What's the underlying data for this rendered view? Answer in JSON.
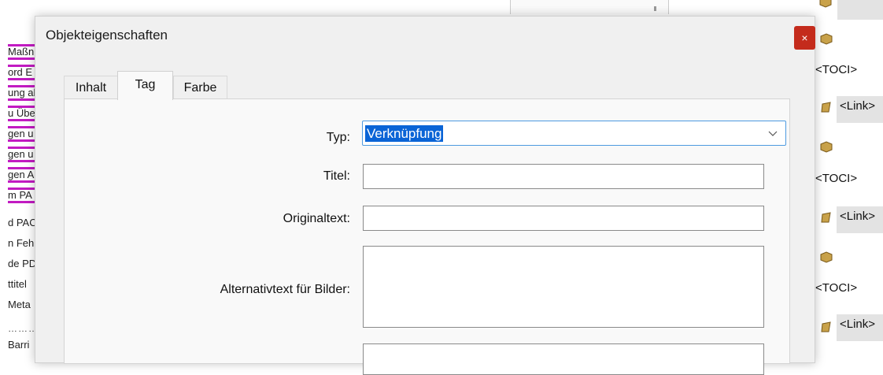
{
  "dialog": {
    "title": "Objekteigenschaften",
    "close_glyph": "×",
    "tabs": [
      {
        "label": "Inhalt",
        "active": false
      },
      {
        "label": "Tag",
        "active": true
      },
      {
        "label": "Farbe",
        "active": false
      }
    ],
    "form": {
      "typ_label": "Typ:",
      "typ_value": "Verknüpfung",
      "titel_label": "Titel:",
      "titel_value": "",
      "original_label": "Originaltext:",
      "original_value": "",
      "alt_label": "Alternativtext für Bilder:",
      "alt_value": ""
    }
  },
  "background_left": {
    "rows": [
      "Maßn",
      "ord E",
      "ung al",
      "u Übe",
      "gen u",
      "gen u",
      "gen A",
      "m PA",
      "d PAC",
      "n Feh",
      "de PD",
      "ttitel",
      "Meta"
    ],
    "dots": "…………",
    "bottom_row": "Barri"
  },
  "background_right": {
    "toci_label": "<TOCI>",
    "link_label": "<Link>"
  },
  "colors": {
    "highlight_magenta": "#c21bc2",
    "close_red": "#c42b1c",
    "selection_blue": "#0a64d6",
    "focus_border": "#4d9ae0"
  }
}
